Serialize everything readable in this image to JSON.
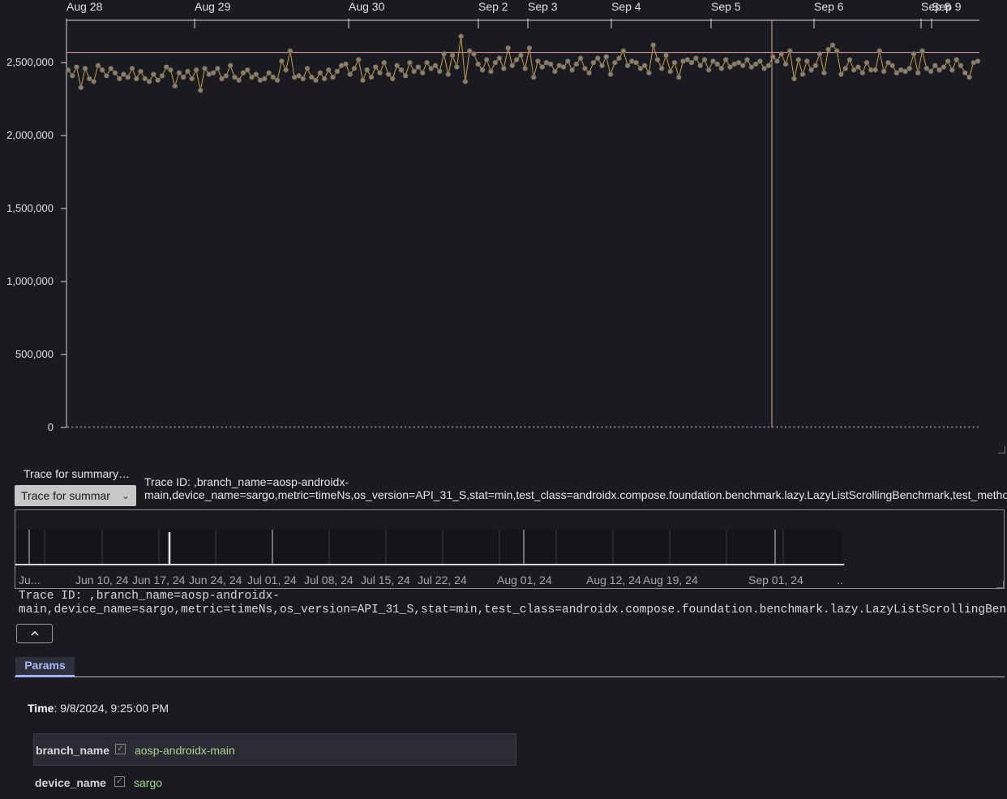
{
  "chart_data": {
    "type": "line",
    "x_tick_labels": [
      "Aug 28",
      "Aug 29",
      "Aug 30",
      "Sep 2",
      "Sep 3",
      "Sep 4",
      "Sep 5",
      "Sep 6",
      "Sep 8",
      "Sep 9"
    ],
    "y_tick_labels": [
      "0",
      "500,000",
      "1,000,000",
      "1,500,000",
      "2,000,000",
      "2,500,000"
    ],
    "ylim": [
      0,
      2500000
    ],
    "grid": false,
    "reference_line_value": 2570000,
    "selected_x_label": "9/8/2024, 9:25:00 PM",
    "series": [
      {
        "values": [
          2450000,
          2410000,
          2470000,
          2330000,
          2460000,
          2390000,
          2370000,
          2480000,
          2450000,
          2410000,
          2460000,
          2430000,
          2390000,
          2420000,
          2400000,
          2460000,
          2390000,
          2440000,
          2390000,
          2370000,
          2420000,
          2380000,
          2410000,
          2470000,
          2450000,
          2340000,
          2430000,
          2400000,
          2440000,
          2390000,
          2450000,
          2310000,
          2460000,
          2420000,
          2430000,
          2460000,
          2390000,
          2410000,
          2480000,
          2400000,
          2380000,
          2430000,
          2450000,
          2400000,
          2420000,
          2380000,
          2390000,
          2430000,
          2400000,
          2380000,
          2510000,
          2450000,
          2580000,
          2400000,
          2410000,
          2390000,
          2460000,
          2400000,
          2380000,
          2430000,
          2390000,
          2450000,
          2400000,
          2440000,
          2480000,
          2490000,
          2420000,
          2460000,
          2520000,
          2380000,
          2450000,
          2400000,
          2470000,
          2430000,
          2500000,
          2420000,
          2390000,
          2480000,
          2450000,
          2410000,
          2500000,
          2440000,
          2470000,
          2430000,
          2500000,
          2460000,
          2480000,
          2440000,
          2560000,
          2420000,
          2550000,
          2470000,
          2680000,
          2370000,
          2580000,
          2560000,
          2490000,
          2450000,
          2520000,
          2440000,
          2500000,
          2530000,
          2460000,
          2600000,
          2480000,
          2520000,
          2550000,
          2460000,
          2600000,
          2400000,
          2510000,
          2470000,
          2500000,
          2490000,
          2440000,
          2480000,
          2470000,
          2510000,
          2450000,
          2490000,
          2530000,
          2460000,
          2430000,
          2500000,
          2530000,
          2480000,
          2540000,
          2420000,
          2500000,
          2530000,
          2580000,
          2480000,
          2510000,
          2500000,
          2460000,
          2480000,
          2430000,
          2620000,
          2520000,
          2460000,
          2550000,
          2440000,
          2500000,
          2400000,
          2510000,
          2520000,
          2500000,
          2530000,
          2480000,
          2520000,
          2450000,
          2510000,
          2490000,
          2460000,
          2520000,
          2470000,
          2490000,
          2500000,
          2480000,
          2520000,
          2470000,
          2490000,
          2510000,
          2460000,
          2480000,
          2540000,
          2510000,
          2560000,
          2490000,
          2580000,
          2390000,
          2520000,
          2420000,
          2510000,
          2450000,
          2480000,
          2560000,
          2430000,
          2590000,
          2620000,
          2580000,
          2420000,
          2460000,
          2520000,
          2450000,
          2470000,
          2430000,
          2500000,
          2450000,
          2450000,
          2580000,
          2440000,
          2500000,
          2480000,
          2430000,
          2450000,
          2440000,
          2460000,
          2560000,
          2430000,
          2580000,
          2460000,
          2440000,
          2480000,
          2450000,
          2470000,
          2510000,
          2450000,
          2520000,
          2480000,
          2430000,
          2400000,
          2500000,
          2510000
        ]
      }
    ]
  },
  "summary_chart": {
    "x_tick_labels": [
      "Ju...",
      "Jun 10, 24",
      "Jun 17, 24",
      "Jun 24, 24",
      "Jul 01, 24",
      "Jul 08, 24",
      "Jul 15, 24",
      "Jul 22, 24",
      "Aug 01, 24",
      "Aug 12, 24",
      "Aug 19, 24",
      "Sep 01, 24",
      ".."
    ]
  },
  "trace_select": {
    "label": "Trace for summary…",
    "value": "Trace for summar",
    "chevron_icon": "chevron-down-icon"
  },
  "trace_id": {
    "line1": "Trace ID: ,branch_name=aosp-androidx-",
    "line2": "main,device_name=sargo,metric=timeNs,os_version=API_31_S,stat=min,test_class=androidx.compose.foundation.benchmark.lazy.LazyListScrollingBenchmark,test_method"
  },
  "trace_id_mono": {
    "line1": "Trace ID: ,branch_name=aosp-androidx-",
    "line2": "main,device_name=sargo,metric=timeNs,os_version=API_31_S,stat=min,test_class=androidx.compose.foundation.benchmark.lazy.LazyListScrollingBenchmark"
  },
  "collapse_button_icon": "chevron-up-icon",
  "tabs": {
    "params": "Params"
  },
  "time": {
    "label": "Time",
    "value": ": 9/8/2024, 9:25:00 PM"
  },
  "params": [
    {
      "key": "branch_name",
      "value": "aosp-androidx-main"
    },
    {
      "key": "device_name",
      "value": "sargo"
    }
  ],
  "colors": {
    "background": "#1a1b21",
    "line": "#c9a04a",
    "point_fill": "#8a7f6a",
    "reference_line": "#e8a4a4",
    "accent": "#a2b4f0",
    "param_value": "#a8d38c"
  }
}
